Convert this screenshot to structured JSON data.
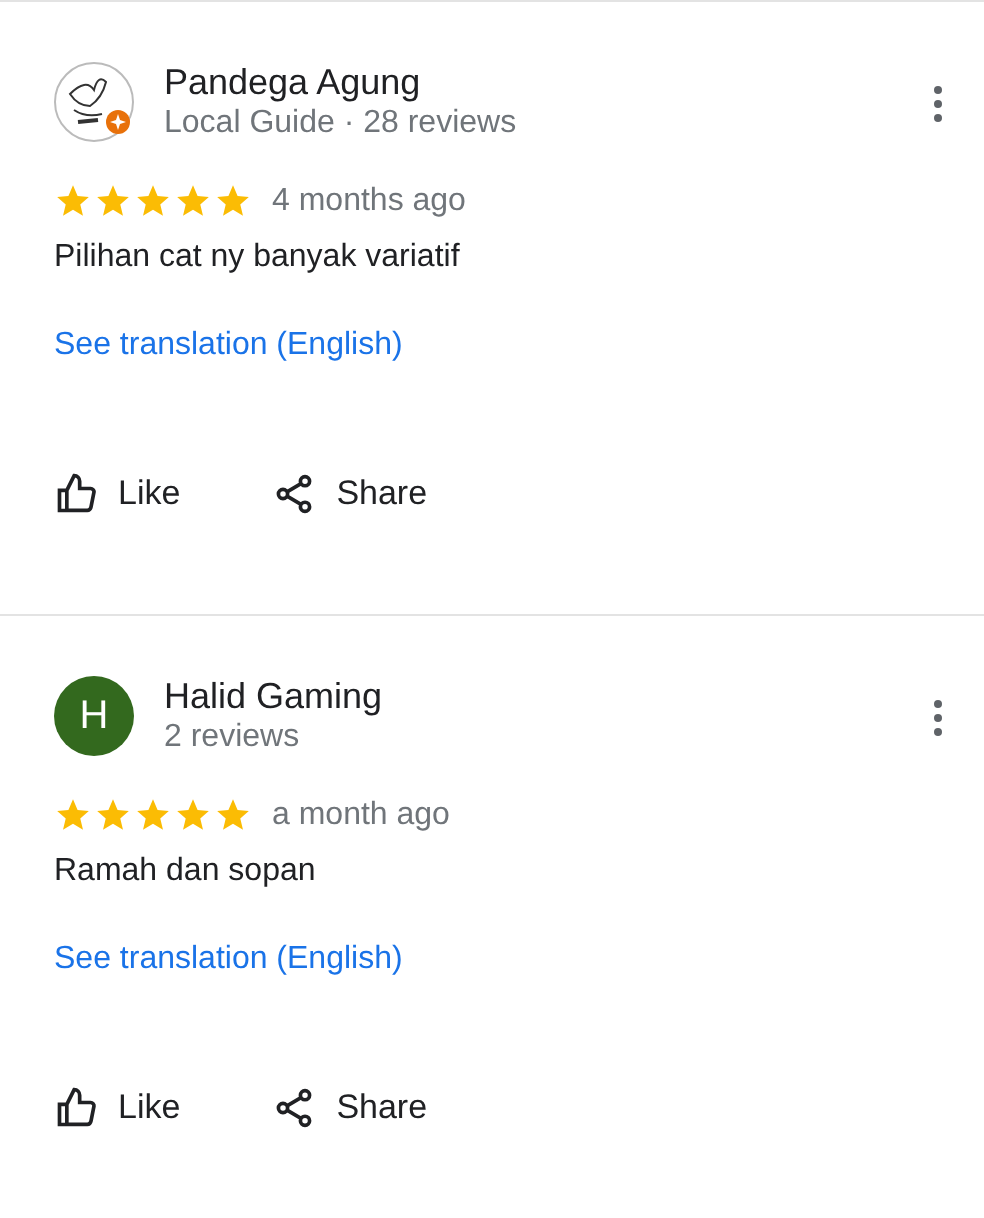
{
  "reviews": [
    {
      "name": "Pandega Agung",
      "meta": "Local Guide · 28 reviews",
      "stars": 5,
      "time": "4 months ago",
      "text": "Pilihan cat ny banyak variatif",
      "translate": "See translation (English)",
      "actions": [
        "Like",
        "Share"
      ]
    },
    {
      "avatar": {
        "kind": "letter",
        "letter": "H",
        "color": "#33691e"
      },
      "name": "Halid Gaming",
      "meta": "2 reviews",
      "stars": 5,
      "time": "a month ago",
      "text": "Ramah dan sopan",
      "translate": "See translation (English)",
      "actions": [
        "Like",
        "Share"
      ]
    }
  ]
}
